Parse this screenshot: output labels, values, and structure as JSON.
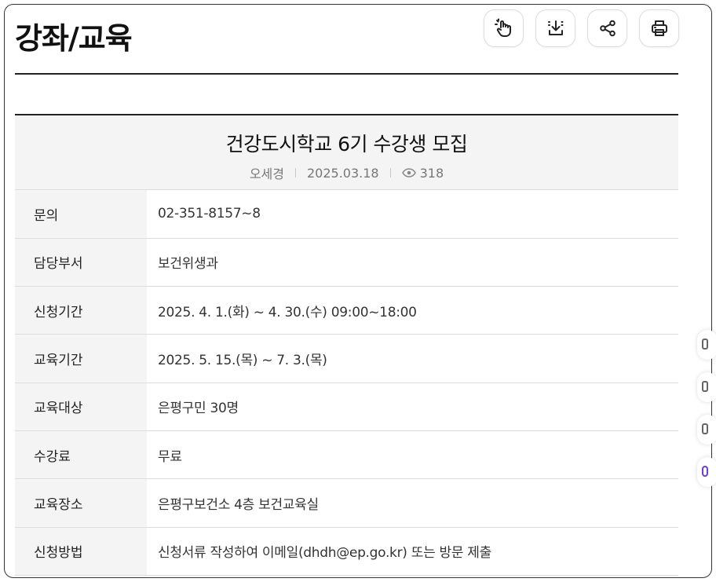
{
  "page": {
    "title": "강좌/교육"
  },
  "toolbar": {
    "buttons": [
      {
        "name": "touch-zoom-button",
        "icon": "hand-touch-icon"
      },
      {
        "name": "download-button",
        "icon": "download-icon"
      },
      {
        "name": "share-button",
        "icon": "share-icon"
      },
      {
        "name": "print-button",
        "icon": "printer-icon"
      }
    ]
  },
  "post": {
    "title": "건강도시학교 6기 수강생 모집",
    "author": "오세경",
    "date": "2025.03.18",
    "views": "318"
  },
  "info_rows": [
    {
      "label": "문의",
      "value": "02-351-8157~8"
    },
    {
      "label": "담당부서",
      "value": "보건위생과"
    },
    {
      "label": "신청기간",
      "value": "2025. 4. 1.(화) ~ 4. 30.(수) 09:00~18:00"
    },
    {
      "label": "교육기간",
      "value": "2025. 5. 15.(목) ~ 7. 3.(목)"
    },
    {
      "label": "교육대상",
      "value": "은평구민 30명"
    },
    {
      "label": "수강료",
      "value": "무료"
    },
    {
      "label": "교육장소",
      "value": "은평구보건소 4층 보건교육실"
    },
    {
      "label": "신청방법",
      "value": "신청서류 작성하여 이메일(dhdh@ep.go.kr) 또는 방문 제출"
    }
  ],
  "colors": {
    "accent": "#6a3fd4",
    "header_bg": "#f4f4f4",
    "rule": "#222222"
  }
}
